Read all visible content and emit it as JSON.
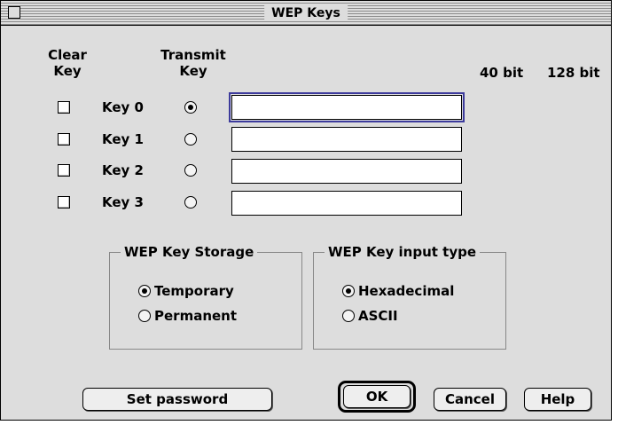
{
  "window": {
    "title": "WEP Keys"
  },
  "headers": {
    "clear_key": "Clear\nKey",
    "transmit_key": "Transmit\nKey",
    "bit40": "40 bit",
    "bit128": "128 bit"
  },
  "keys": [
    {
      "label": "Key 0",
      "transmit_selected": true,
      "clear_checked": false,
      "value": ""
    },
    {
      "label": "Key 1",
      "transmit_selected": false,
      "clear_checked": false,
      "value": ""
    },
    {
      "label": "Key 2",
      "transmit_selected": false,
      "clear_checked": false,
      "value": ""
    },
    {
      "label": "Key 3",
      "transmit_selected": false,
      "clear_checked": false,
      "value": ""
    }
  ],
  "storage": {
    "legend": "WEP Key Storage",
    "options": [
      {
        "label": "Temporary",
        "selected": true
      },
      {
        "label": "Permanent",
        "selected": false
      }
    ]
  },
  "input_type": {
    "legend": "WEP Key input type",
    "options": [
      {
        "label": "Hexadecimal",
        "selected": true
      },
      {
        "label": "ASCII",
        "selected": false
      }
    ]
  },
  "buttons": {
    "set_password": "Set password",
    "ok": "OK",
    "cancel": "Cancel",
    "help": "Help"
  }
}
